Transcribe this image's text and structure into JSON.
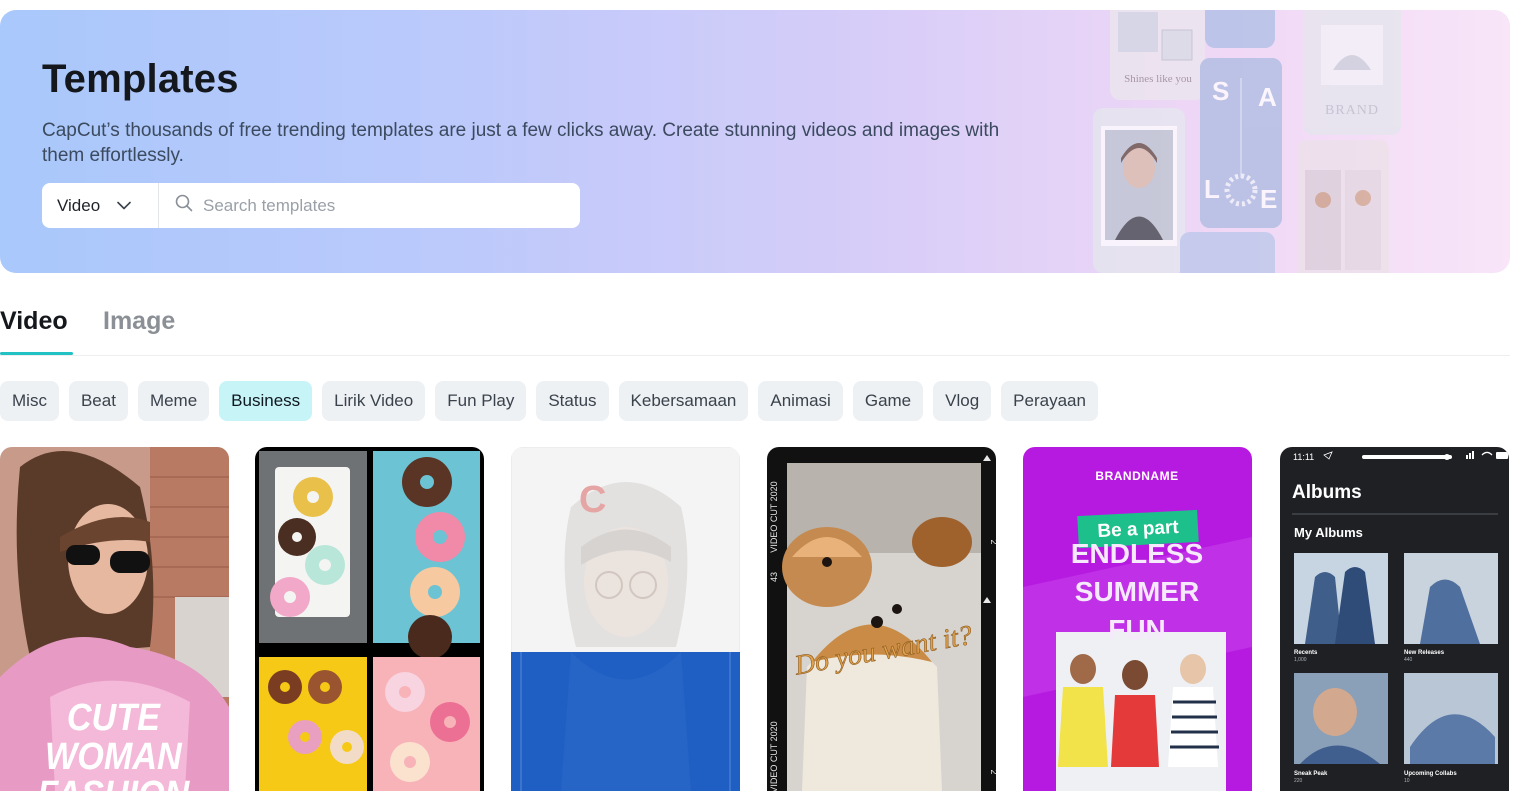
{
  "hero": {
    "title": "Templates",
    "description": "CapCut’s thousands of free trending templates are just a few clicks away. Create stunning videos and images with them effortlessly.",
    "type_selector": {
      "selected": "Video",
      "icon": "chevron-down-icon"
    },
    "search": {
      "placeholder": "Search templates",
      "value": "",
      "icon": "search-icon"
    },
    "collage": {
      "shines_text": "Shines like you",
      "sale_letters": [
        "S",
        "A",
        "L",
        "E"
      ],
      "brand_text": "BRAND"
    }
  },
  "tabs": [
    {
      "label": "Video",
      "active": true
    },
    {
      "label": "Image",
      "active": false
    }
  ],
  "categories": [
    {
      "label": "Misc",
      "active": false
    },
    {
      "label": "Beat",
      "active": false
    },
    {
      "label": "Meme",
      "active": false
    },
    {
      "label": "Business",
      "active": true
    },
    {
      "label": "Lirik Video",
      "active": false
    },
    {
      "label": "Fun Play",
      "active": false
    },
    {
      "label": "Status",
      "active": false
    },
    {
      "label": "Kebersamaan",
      "active": false
    },
    {
      "label": "Animasi",
      "active": false
    },
    {
      "label": "Game",
      "active": false
    },
    {
      "label": "Vlog",
      "active": false
    },
    {
      "label": "Perayaan",
      "active": false
    }
  ],
  "cards": {
    "c1": {
      "lines": [
        "CUTE",
        "WOMAN",
        "FASHION"
      ]
    },
    "c2": {},
    "c3": {
      "letter": "C"
    },
    "c4": {
      "caption": "Do you want it?",
      "film_text": "VIDEO CUT 2020",
      "film_number": "43",
      "film_mark": "2"
    },
    "c5": {
      "brand": "BRANDNAME",
      "banner": "Be a part",
      "lines": [
        "ENDLESS",
        "SUMMER",
        "FUN"
      ]
    },
    "c6": {
      "time": "11:11",
      "title": "Albums",
      "section": "My Albums",
      "albums": [
        {
          "name": "Recents",
          "count": "1,000"
        },
        {
          "name": "New Releases",
          "count": "440"
        },
        {
          "name": "Sneak Peak",
          "count": "220"
        },
        {
          "name": "Upcoming Collabs",
          "count": "10"
        }
      ]
    }
  },
  "colors": {
    "accent": "#22c1c3",
    "chip_active_bg": "#c7f4f6",
    "chip_bg": "#eef1f4",
    "summer_purple": "#b61ae0",
    "summer_green": "#1dbf8a",
    "album_dark": "#1e2023"
  }
}
